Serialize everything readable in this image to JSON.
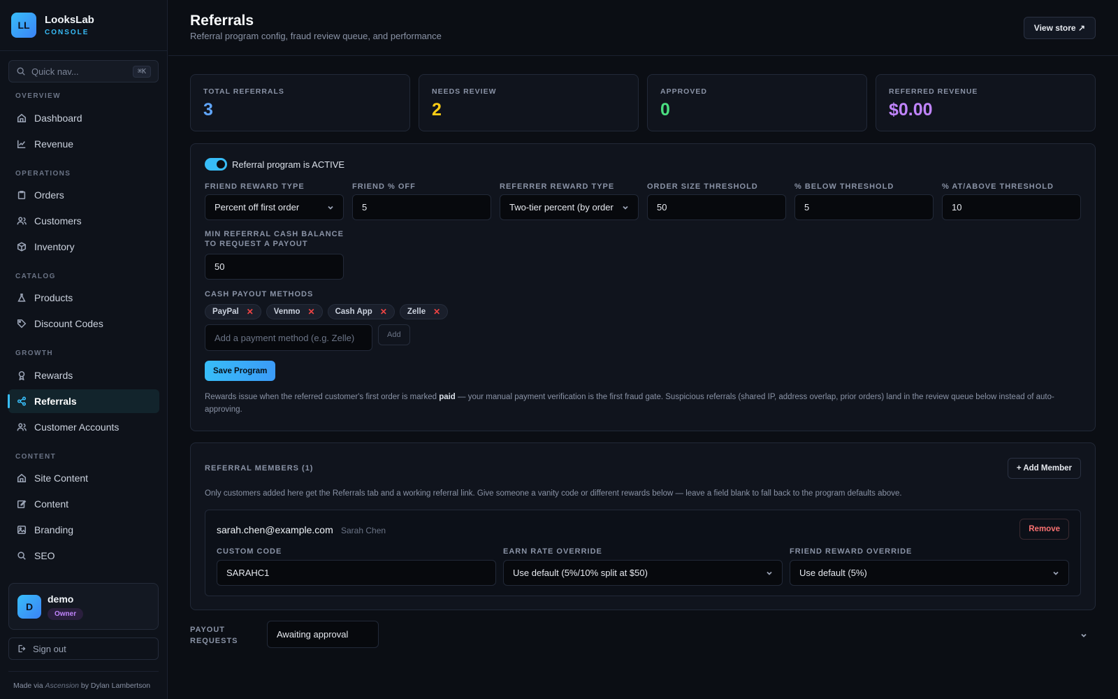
{
  "brand": {
    "initials": "LL",
    "name": "LooksLab",
    "sub": "CONSOLE"
  },
  "quick_nav": {
    "placeholder": "Quick nav...",
    "shortcut": "⌘K"
  },
  "nav": {
    "sections": [
      "OVERVIEW",
      "OPERATIONS",
      "CATALOG",
      "GROWTH",
      "CONTENT"
    ],
    "items": [
      {
        "label": "Dashboard",
        "icon": "home-icon"
      },
      {
        "label": "Revenue",
        "icon": "chart-line-icon"
      },
      {
        "label": "Orders",
        "icon": "clipboard-icon"
      },
      {
        "label": "Customers",
        "icon": "users-icon"
      },
      {
        "label": "Inventory",
        "icon": "box-icon"
      },
      {
        "label": "Products",
        "icon": "flask-icon"
      },
      {
        "label": "Discount Codes",
        "icon": "tag-icon"
      },
      {
        "label": "Rewards",
        "icon": "award-icon"
      },
      {
        "label": "Referrals",
        "icon": "share-icon",
        "active": true
      },
      {
        "label": "Customer Accounts",
        "icon": "users-icon"
      },
      {
        "label": "Site Content",
        "icon": "home-icon"
      },
      {
        "label": "Content",
        "icon": "edit-icon"
      },
      {
        "label": "Branding",
        "icon": "image-icon"
      },
      {
        "label": "SEO",
        "icon": "search-icon"
      }
    ]
  },
  "user": {
    "initial": "D",
    "name": "demo",
    "role": "Owner"
  },
  "signout": "Sign out",
  "footer": {
    "prefix": "Made via",
    "tool": "Ascension",
    "suffix": "by Dylan Lambertson"
  },
  "header": {
    "title": "Referrals",
    "subtitle": "Referral program config, fraud review queue, and performance",
    "view_store": "View store ↗"
  },
  "stats": [
    {
      "label": "TOTAL REFERRALS",
      "value": "3",
      "color": "#60a5fa"
    },
    {
      "label": "NEEDS REVIEW",
      "value": "2",
      "color": "#facc15"
    },
    {
      "label": "APPROVED",
      "value": "0",
      "color": "#4ade80"
    },
    {
      "label": "REFERRED REVENUE",
      "value": "$0.00",
      "color": "#c084fc"
    }
  ],
  "program": {
    "toggle_label": "Referral program is ACTIVE",
    "fields": {
      "friend_reward_type": {
        "label": "FRIEND REWARD TYPE",
        "value": "Percent off first order"
      },
      "friend_pct_off": {
        "label": "FRIEND % OFF",
        "value": "5"
      },
      "referrer_reward_type": {
        "label": "REFERRER REWARD TYPE",
        "value": "Two-tier percent (by order"
      },
      "order_size_threshold": {
        "label": "ORDER SIZE THRESHOLD",
        "value": "50"
      },
      "pct_below": {
        "label": "% BELOW THRESHOLD",
        "value": "5"
      },
      "pct_above": {
        "label": "% AT/ABOVE THRESHOLD",
        "value": "10"
      },
      "min_balance": {
        "label": "MIN REFERRAL CASH BALANCE TO REQUEST A PAYOUT",
        "value": "50"
      }
    },
    "payout_methods_label": "CASH PAYOUT METHODS",
    "payout_methods": [
      "PayPal",
      "Venmo",
      "Cash App",
      "Zelle"
    ],
    "add_method_placeholder": "Add a payment method (e.g. Zelle)",
    "add_label": "Add",
    "save_label": "Save Program",
    "note_pre": "Rewards issue when the referred customer's first order is marked",
    "note_bold": "paid",
    "note_post": "— your manual payment verification is the first fraud gate. Suspicious referrals (shared IP, address overlap, prior orders) land in the review queue below instead of auto-approving."
  },
  "members": {
    "title": "REFERRAL MEMBERS (1)",
    "add_label": "+ Add Member",
    "description": "Only customers added here get the Referrals tab and a working referral link. Give someone a vanity code or different rewards below — leave a field blank to fall back to the program defaults above.",
    "list": [
      {
        "email": "sarah.chen@example.com",
        "name": "Sarah Chen",
        "remove_label": "Remove",
        "custom_code_label": "CUSTOM CODE",
        "custom_code": "SARAHC1",
        "earn_rate_label": "EARN RATE OVERRIDE",
        "earn_rate": "Use default (5%/10% split at $50)",
        "friend_reward_label": "FRIEND REWARD OVERRIDE",
        "friend_reward": "Use default (5%)"
      }
    ]
  },
  "payouts": {
    "label": "PAYOUT REQUESTS",
    "filter": "Awaiting approval"
  }
}
